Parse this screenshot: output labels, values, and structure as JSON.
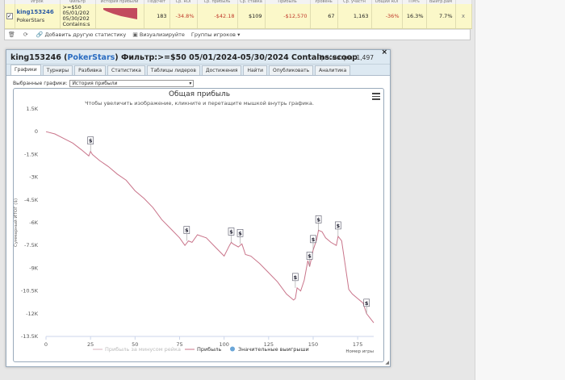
{
  "stats_table": {
    "headers": [
      "",
      "Игрок",
      "Фильтр",
      "История прибыли",
      "Подсчет",
      "Ср. ROI",
      "Ср. прибыль",
      "Ср. ставка",
      "Прибыль",
      "Уровень",
      "Ср. участн",
      "Общий ROI",
      "ITM%",
      "Выигр.рам",
      ""
    ],
    "row": {
      "player": "king153246",
      "room": "PokerStars",
      "filter_lines": [
        ">=$50",
        "05/01/202",
        "05/30/202",
        "Contains:s"
      ],
      "count": "183",
      "avg_roi": "-34.8%",
      "avg_profit": "-$42.18",
      "avg_stake": "$109",
      "profit": "-$12,570",
      "level": "67",
      "avg_entrants": "1,163",
      "total_roi": "-36%",
      "itm": "16.3%",
      "win_rate": "7.7%"
    },
    "toolbar": {
      "add_stat": "Добавить другую статистику",
      "visualize": "Визуализируйте",
      "player_groups": "Группы игроков ▾"
    }
  },
  "modal": {
    "player": "king153246",
    "room": "PokerStars",
    "filter": "Фильтр:>=$50 05/01/2024-05/30/2024 Contains:scoop",
    "views_label": "Просмотры: 1,497",
    "close": "×",
    "tabs": [
      "Графики",
      "Турниры",
      "Разбивка",
      "Статистика",
      "Таблицы лидеров",
      "Достижения",
      "Найти",
      "Опубликовать",
      "Аналитика"
    ],
    "charts_label": "Выбранные графики:",
    "charts_selected": "История прибыли"
  },
  "chart_data": {
    "type": "line",
    "title": "Общая прибыль",
    "subtitle": "Чтобы увеличить изображение, кликните и перетащите мышкой внутрь графика.",
    "ylabel": "Суммарный ИТОГ ($)",
    "xlabel": "Номер игры",
    "ylim": [
      -13500,
      1500
    ],
    "xlim": [
      0,
      184
    ],
    "y_ticks": [
      1500,
      0,
      -1500,
      -3000,
      -4500,
      -6000,
      -7500,
      -9000,
      -10500,
      -12000,
      -13500
    ],
    "y_tick_labels": [
      "1.5K",
      "0",
      "-1.5K",
      "-3K",
      "-4.5K",
      "-6K",
      "-7.5K",
      "-9K",
      "-10.5K",
      "-12K",
      "-13.5K"
    ],
    "x_ticks": [
      0,
      25,
      50,
      75,
      100,
      125,
      150,
      175
    ],
    "grid": false,
    "legend_position": "bottom",
    "legend": [
      "Прибыль за минусом рейка",
      "Прибыль",
      "Значительные выигрыши"
    ],
    "colors": {
      "profit": "#c9748a",
      "rake": "#d8b3bd",
      "win_marker": "#6aa6d8"
    },
    "series": [
      {
        "name": "Прибыль",
        "x": [
          0,
          5,
          10,
          15,
          20,
          24,
          25,
          26,
          30,
          35,
          40,
          45,
          50,
          55,
          60,
          65,
          70,
          75,
          78,
          80,
          82,
          85,
          90,
          95,
          100,
          103,
          104,
          105,
          108,
          110,
          112,
          115,
          120,
          125,
          130,
          135,
          139,
          140,
          141,
          143,
          145,
          147,
          148,
          150,
          152,
          153,
          155,
          157,
          160,
          163,
          164,
          166,
          168,
          170,
          172,
          175,
          178,
          180,
          182,
          184
        ],
        "y": [
          0,
          -150,
          -450,
          -750,
          -1200,
          -1600,
          -1300,
          -1500,
          -1900,
          -2300,
          -2800,
          -3200,
          -3900,
          -4400,
          -5000,
          -5800,
          -6400,
          -7000,
          -7500,
          -7200,
          -7300,
          -6800,
          -7000,
          -7600,
          -8200,
          -7500,
          -7300,
          -7400,
          -7600,
          -7400,
          -8100,
          -8200,
          -8700,
          -9300,
          -9900,
          -10700,
          -11100,
          -11000,
          -10300,
          -10500,
          -9800,
          -8500,
          -8900,
          -7800,
          -7100,
          -6500,
          -6600,
          -7000,
          -7300,
          -7500,
          -6900,
          -7200,
          -8800,
          -10400,
          -10700,
          -11000,
          -11300,
          -12000,
          -12300,
          -12600
        ]
      }
    ],
    "significant_wins": [
      {
        "x": 25,
        "y": -1300
      },
      {
        "x": 79,
        "y": -7200
      },
      {
        "x": 104,
        "y": -7300
      },
      {
        "x": 109,
        "y": -7400
      },
      {
        "x": 140,
        "y": -10300
      },
      {
        "x": 148,
        "y": -8900
      },
      {
        "x": 150,
        "y": -7800
      },
      {
        "x": 153,
        "y": -6500
      },
      {
        "x": 164,
        "y": -6900
      },
      {
        "x": 180,
        "y": -12000
      }
    ],
    "win_marker_symbol": "$"
  }
}
